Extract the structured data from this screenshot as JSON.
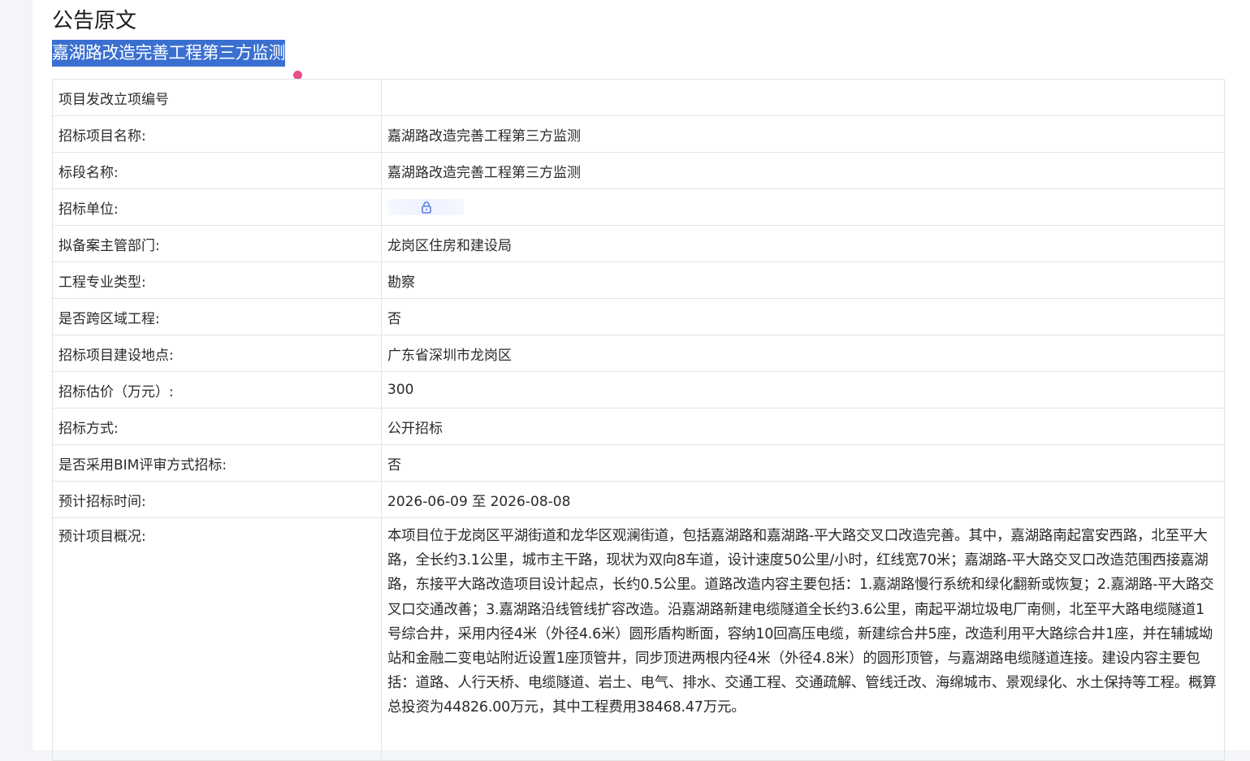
{
  "page": {
    "heading": "公告原文",
    "project_title": "嘉湖路改造完善工程第三方监测"
  },
  "table": {
    "rows": [
      {
        "label": "项目发改立项编号",
        "value": ""
      },
      {
        "label": "招标项目名称:",
        "value": "嘉湖路改造完善工程第三方监测"
      },
      {
        "label": "标段名称:",
        "value": "嘉湖路改造完善工程第三方监测"
      },
      {
        "label": "招标单位:",
        "value": "",
        "value_icon": "lock-icon"
      },
      {
        "label": "拟备案主管部门:",
        "value": "龙岗区住房和建设局"
      },
      {
        "label": "工程专业类型:",
        "value": "勘察"
      },
      {
        "label": "是否跨区域工程:",
        "value": "否"
      },
      {
        "label": "招标项目建设地点:",
        "value": "广东省深圳市龙岗区"
      },
      {
        "label": "招标估价（万元）:",
        "value": "300"
      },
      {
        "label": "招标方式:",
        "value": "公开招标"
      },
      {
        "label": "是否采用BIM评审方式招标:",
        "value": "否"
      },
      {
        "label": "预计招标时间:",
        "value": "2026-06-09 至 2026-08-08"
      },
      {
        "label": "预计项目概况:",
        "value": "本项目位于龙岗区平湖街道和龙华区观澜街道，包括嘉湖路和嘉湖路-平大路交叉口改造完善。其中，嘉湖路南起富安西路，北至平大路，全长约3.1公里，城市主干路，现状为双向8车道，设计速度50公里/小时，红线宽70米；嘉湖路-平大路交叉口改造范围西接嘉湖路，东接平大路改造项目设计起点，长约0.5公里。道路改造内容主要包括：1.嘉湖路慢行系统和绿化翻新或恢复；2.嘉湖路-平大路交叉口交通改善；3.嘉湖路沿线管线扩容改造。沿嘉湖路新建电缆隧道全长约3.6公里，南起平湖垃圾电厂南侧，北至平大路电缆隧道1号综合井，采用内径4米（外径4.6米）圆形盾构断面，容纳10回高压电缆，新建综合井5座，改造利用平大路综合井1座，并在辅城坳站和金融二变电站附近设置1座顶管井，同步顶进两根内径4米（外径4.8米）的圆形顶管，与嘉湖路电缆隧道连接。建设内容主要包括：道路、人行天桥、电缆隧道、岩土、电气、排水、交通工程、交通疏解、管线迁改、海绵城市、景观绿化、水土保持等工程。概算总投资为44826.00万元，其中工程费用38468.47万元。"
      }
    ]
  },
  "colors": {
    "selection_bg": "#3a6fd0",
    "caret": "#ea4e88",
    "lock_icon": "#5b7de0"
  }
}
